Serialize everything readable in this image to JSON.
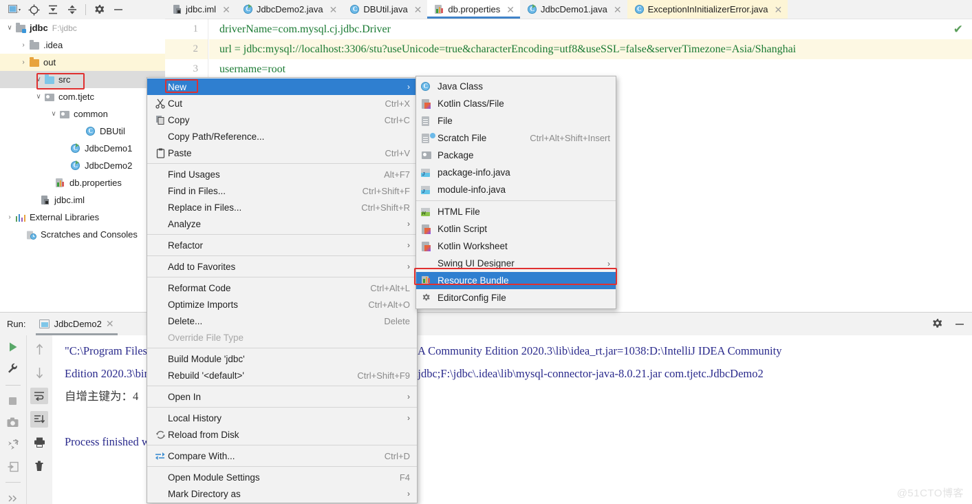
{
  "toolbar": {
    "buttons": [
      {
        "name": "project-view-icon",
        "glyph": "window"
      },
      {
        "name": "locate-icon",
        "glyph": "target"
      },
      {
        "name": "expand-all-icon",
        "glyph": "expand"
      },
      {
        "name": "collapse-all-icon",
        "glyph": "collapse"
      },
      {
        "name": "settings-icon",
        "glyph": "gear"
      },
      {
        "name": "hide-icon",
        "glyph": "minus"
      }
    ]
  },
  "tabs": [
    {
      "label": "jdbc.iml",
      "icon": "iml-file-icon",
      "state": "normal"
    },
    {
      "label": "JdbcDemo2.java",
      "icon": "java-runnable-icon",
      "state": "normal"
    },
    {
      "label": "DBUtil.java",
      "icon": "java-class-icon",
      "state": "normal"
    },
    {
      "label": "db.properties",
      "icon": "properties-file-icon",
      "state": "active"
    },
    {
      "label": "JdbcDemo1.java",
      "icon": "java-runnable-icon",
      "state": "normal"
    },
    {
      "label": "ExceptionInInitializerError.java",
      "icon": "java-class-icon",
      "state": "highlight"
    }
  ],
  "tab_close_glyph": "✕",
  "editor": {
    "lines": [
      {
        "number": "1",
        "text": "driverName=com.mysql.cj.jdbc.Driver",
        "highlight": false
      },
      {
        "number": "2",
        "text": "url = jdbc:mysql://localhost:3306/stu?useUnicode=true&characterEncoding=utf8&useSSL=false&serverTimezone=Asia/Shanghai",
        "highlight": true
      },
      {
        "number": "3",
        "text": "username=root",
        "highlight": false
      }
    ],
    "inspection_status": "✔"
  },
  "tree": {
    "items": [
      {
        "arrow": "∨",
        "icon": "folder-module-icon",
        "label": "jdbc",
        "path": "F:\\jdbc",
        "indent": 0,
        "bold": true,
        "selection": "none"
      },
      {
        "arrow": "›",
        "icon": "folder-grey-icon",
        "label": ".idea",
        "path": "",
        "indent": 1,
        "bold": false,
        "selection": "none"
      },
      {
        "arrow": "›",
        "icon": "folder-orange-icon",
        "label": "out",
        "path": "",
        "indent": 1,
        "bold": false,
        "selection": "yellow"
      },
      {
        "arrow": "∨",
        "icon": "folder-source-icon",
        "label": "src",
        "path": "",
        "indent": 1,
        "bold": false,
        "selection": "grey"
      },
      {
        "arrow": "∨",
        "icon": "package-icon",
        "label": "com.tjetc",
        "path": "",
        "indent": 2,
        "bold": false,
        "selection": "none"
      },
      {
        "arrow": "∨",
        "icon": "package-icon",
        "label": "common",
        "path": "",
        "indent": 3,
        "bold": false,
        "selection": "none"
      },
      {
        "arrow": "",
        "icon": "java-class-icon",
        "label": "DBUtil",
        "path": "",
        "indent": 4,
        "bold": false,
        "selection": "none"
      },
      {
        "arrow": "",
        "icon": "java-runnable-icon",
        "label": "JdbcDemo1",
        "path": "",
        "indent": 3,
        "bold": false,
        "selection": "none"
      },
      {
        "arrow": "",
        "icon": "java-runnable-icon",
        "label": "JdbcDemo2",
        "path": "",
        "indent": 3,
        "bold": false,
        "selection": "none"
      },
      {
        "arrow": "",
        "icon": "properties-file-icon",
        "label": "db.properties",
        "path": "",
        "indent": 2,
        "bold": false,
        "selection": "none"
      },
      {
        "arrow": "",
        "icon": "iml-file-icon",
        "label": "jdbc.iml",
        "path": "",
        "indent": 1,
        "bold": false,
        "selection": "none"
      },
      {
        "arrow": "›",
        "icon": "external-libraries-icon",
        "label": "External Libraries",
        "path": "",
        "indent": 0,
        "bold": false,
        "selection": "none"
      },
      {
        "arrow": "",
        "icon": "scratches-icon",
        "label": "Scratches and Consoles",
        "path": "",
        "indent": 0,
        "bold": false,
        "selection": "none"
      }
    ]
  },
  "context_menu": {
    "items": [
      {
        "type": "item",
        "label": "New",
        "shortcut": "",
        "icon": "",
        "arrow": "›",
        "selected": true,
        "disabled": false,
        "mnemonic": ""
      },
      {
        "type": "item",
        "label": "Cut",
        "shortcut": "Ctrl+X",
        "icon": "scissors-icon",
        "arrow": "",
        "selected": false,
        "disabled": false,
        "mnemonic": "t"
      },
      {
        "type": "item",
        "label": "Copy",
        "shortcut": "Ctrl+C",
        "icon": "copy-icon",
        "arrow": "",
        "selected": false,
        "disabled": false,
        "mnemonic": "C"
      },
      {
        "type": "item",
        "label": "Copy Path/Reference...",
        "shortcut": "",
        "icon": "",
        "arrow": "",
        "selected": false,
        "disabled": false,
        "mnemonic": ""
      },
      {
        "type": "item",
        "label": "Paste",
        "shortcut": "Ctrl+V",
        "icon": "clipboard-icon",
        "arrow": "",
        "selected": false,
        "disabled": false,
        "mnemonic": "P"
      },
      {
        "type": "sep"
      },
      {
        "type": "item",
        "label": "Find Usages",
        "shortcut": "Alt+F7",
        "icon": "",
        "arrow": "",
        "selected": false,
        "disabled": false,
        "mnemonic": "U"
      },
      {
        "type": "item",
        "label": "Find in Files...",
        "shortcut": "Ctrl+Shift+F",
        "icon": "",
        "arrow": "",
        "selected": false,
        "disabled": false,
        "mnemonic": ""
      },
      {
        "type": "item",
        "label": "Replace in Files...",
        "shortcut": "Ctrl+Shift+R",
        "icon": "",
        "arrow": "",
        "selected": false,
        "disabled": false,
        "mnemonic": "a"
      },
      {
        "type": "item",
        "label": "Analyze",
        "shortcut": "",
        "icon": "",
        "arrow": "›",
        "selected": false,
        "disabled": false,
        "mnemonic": "z"
      },
      {
        "type": "sep"
      },
      {
        "type": "item",
        "label": "Refactor",
        "shortcut": "",
        "icon": "",
        "arrow": "›",
        "selected": false,
        "disabled": false,
        "mnemonic": "R"
      },
      {
        "type": "sep"
      },
      {
        "type": "item",
        "label": "Add to Favorites",
        "shortcut": "",
        "icon": "",
        "arrow": "›",
        "selected": false,
        "disabled": false,
        "mnemonic": "v"
      },
      {
        "type": "sep"
      },
      {
        "type": "item",
        "label": "Reformat Code",
        "shortcut": "Ctrl+Alt+L",
        "icon": "",
        "arrow": "",
        "selected": false,
        "disabled": false,
        "mnemonic": "R"
      },
      {
        "type": "item",
        "label": "Optimize Imports",
        "shortcut": "Ctrl+Alt+O",
        "icon": "",
        "arrow": "",
        "selected": false,
        "disabled": false,
        "mnemonic": "z"
      },
      {
        "type": "item",
        "label": "Delete...",
        "shortcut": "Delete",
        "icon": "",
        "arrow": "",
        "selected": false,
        "disabled": false,
        "mnemonic": "D"
      },
      {
        "type": "item",
        "label": "Override File Type",
        "shortcut": "",
        "icon": "",
        "arrow": "",
        "selected": false,
        "disabled": true,
        "mnemonic": ""
      },
      {
        "type": "sep"
      },
      {
        "type": "item",
        "label": "Build Module 'jdbc'",
        "shortcut": "",
        "icon": "",
        "arrow": "",
        "selected": false,
        "disabled": false,
        "mnemonic": "M"
      },
      {
        "type": "item",
        "label": "Rebuild '<default>'",
        "shortcut": "Ctrl+Shift+F9",
        "icon": "",
        "arrow": "",
        "selected": false,
        "disabled": false,
        "mnemonic": "e"
      },
      {
        "type": "sep"
      },
      {
        "type": "item",
        "label": "Open In",
        "shortcut": "",
        "icon": "",
        "arrow": "›",
        "selected": false,
        "disabled": false,
        "mnemonic": ""
      },
      {
        "type": "sep"
      },
      {
        "type": "item",
        "label": "Local History",
        "shortcut": "",
        "icon": "",
        "arrow": "›",
        "selected": false,
        "disabled": false,
        "mnemonic": "H"
      },
      {
        "type": "item",
        "label": "Reload from Disk",
        "shortcut": "",
        "icon": "reload-icon",
        "arrow": "",
        "selected": false,
        "disabled": false,
        "mnemonic": ""
      },
      {
        "type": "sep"
      },
      {
        "type": "item",
        "label": "Compare With...",
        "shortcut": "Ctrl+D",
        "icon": "compare-icon",
        "arrow": "",
        "selected": false,
        "disabled": false,
        "mnemonic": ""
      },
      {
        "type": "sep"
      },
      {
        "type": "item",
        "label": "Open Module Settings",
        "shortcut": "F4",
        "icon": "",
        "arrow": "",
        "selected": false,
        "disabled": false,
        "mnemonic": ""
      },
      {
        "type": "item",
        "label": "Mark Directory as",
        "shortcut": "",
        "icon": "",
        "arrow": "›",
        "selected": false,
        "disabled": false,
        "mnemonic": ""
      }
    ]
  },
  "submenu": {
    "items": [
      {
        "type": "item",
        "label": "Java Class",
        "shortcut": "",
        "icon": "java-class-icon",
        "arrow": "",
        "selected": false
      },
      {
        "type": "item",
        "label": "Kotlin Class/File",
        "shortcut": "",
        "icon": "kotlin-file-icon",
        "arrow": "",
        "selected": false
      },
      {
        "type": "item",
        "label": "File",
        "shortcut": "",
        "icon": "file-icon",
        "arrow": "",
        "selected": false
      },
      {
        "type": "item",
        "label": "Scratch File",
        "shortcut": "Ctrl+Alt+Shift+Insert",
        "icon": "scratch-file-icon",
        "arrow": "",
        "selected": false
      },
      {
        "type": "item",
        "label": "Package",
        "shortcut": "",
        "icon": "package-icon",
        "arrow": "",
        "selected": false
      },
      {
        "type": "item",
        "label": "package-info.java",
        "shortcut": "",
        "icon": "java-info-icon",
        "arrow": "",
        "selected": false
      },
      {
        "type": "item",
        "label": "module-info.java",
        "shortcut": "",
        "icon": "java-info-icon",
        "arrow": "",
        "selected": false
      },
      {
        "type": "sep"
      },
      {
        "type": "item",
        "label": "HTML File",
        "shortcut": "",
        "icon": "html-file-icon",
        "arrow": "",
        "selected": false
      },
      {
        "type": "item",
        "label": "Kotlin Script",
        "shortcut": "",
        "icon": "kotlin-file-icon",
        "arrow": "",
        "selected": false
      },
      {
        "type": "item",
        "label": "Kotlin Worksheet",
        "shortcut": "",
        "icon": "kotlin-file-icon",
        "arrow": "",
        "selected": false
      },
      {
        "type": "item",
        "label": "Swing UI Designer",
        "shortcut": "",
        "icon": "",
        "arrow": "›",
        "selected": false
      },
      {
        "type": "item",
        "label": "Resource Bundle",
        "shortcut": "",
        "icon": "properties-file-icon",
        "arrow": "",
        "selected": true
      },
      {
        "type": "item",
        "label": "EditorConfig File",
        "shortcut": "",
        "icon": "gear-icon",
        "arrow": "",
        "selected": false
      }
    ]
  },
  "run_panel": {
    "label": "Run:",
    "tab_label": "JdbcDemo2",
    "tab_close_glyph": "✕",
    "console_lines": [
      {
        "text": "\"C:\\Program Files\\Java\\jdk1.8.0_131\\bin\\java.exe\" -javaagent:D:\\IntelliJ IDEA Community Edition 2020.3\\lib\\idea_rt.jar=1038:D:\\IntelliJ IDEA Community",
        "cn": false
      },
      {
        "text": "Edition 2020.3\\bin -Dfile.encoding=UTF-8 -classpath F:\\jdbc\\out\\production\\jdbc;F:\\jdbc\\.idea\\lib\\mysql-connector-java-8.0.21.jar com.tjetc.JdbcDemo2",
        "cn": false
      },
      {
        "text": "自增主键为：4",
        "cn": true
      },
      {
        "text": "",
        "cn": false
      },
      {
        "text": "Process finished with exit code 0",
        "cn": false
      }
    ],
    "left_tools": [
      {
        "name": "rerun-icon"
      },
      {
        "name": "wrench-icon"
      },
      {
        "name": "stop-icon"
      },
      {
        "name": "camera-icon"
      },
      {
        "name": "debug-icon"
      },
      {
        "name": "export-icon"
      },
      {
        "name": "more-icon"
      }
    ],
    "right_tools": [
      {
        "name": "scroll-up-icon"
      },
      {
        "name": "scroll-down-icon"
      },
      {
        "name": "soft-wrap-icon"
      },
      {
        "name": "scroll-to-end-icon"
      },
      {
        "name": "print-icon"
      },
      {
        "name": "clear-all-icon"
      }
    ],
    "header_tools": [
      {
        "name": "settings-icon"
      },
      {
        "name": "hide-icon"
      }
    ]
  },
  "watermark": "@51CTO博客",
  "colors": {
    "selection_blue": "#2f7fd0",
    "highlight_red": "#e03030",
    "tab_underline": "#4083c9",
    "code_green": "#1a7a33",
    "console_blue": "#2a2a8c",
    "run_green": "#59a869",
    "panel_grey": "#f2f2f2"
  }
}
